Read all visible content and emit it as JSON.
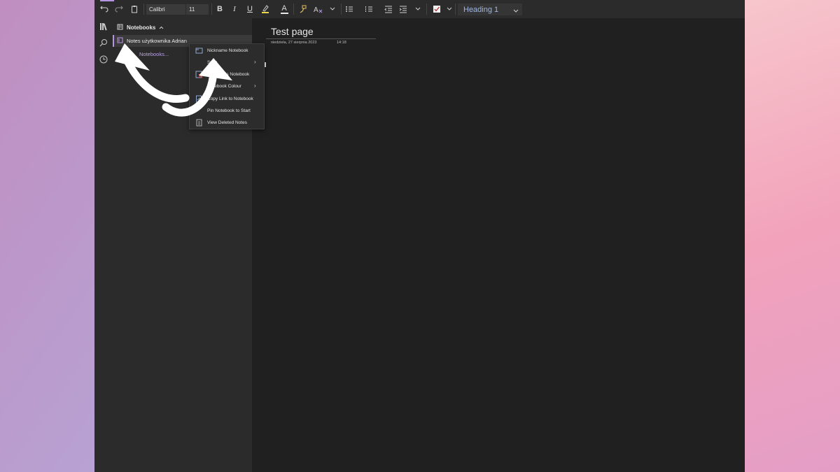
{
  "toolbar": {
    "font_name": "Calibri",
    "font_size": "11",
    "style": "Heading 1",
    "icons": [
      "undo-icon",
      "redo-icon",
      "clipboard-icon",
      "bold-icon",
      "italic-icon",
      "underline-icon",
      "highlight-icon",
      "font-color-icon",
      "format-painter-icon",
      "clear-format-icon",
      "bullets-icon",
      "numbering-icon",
      "outdent-icon",
      "indent-icon",
      "todo-checkbox-icon"
    ],
    "bold_glyph": "B",
    "italic_glyph": "I",
    "underline_glyph": "U",
    "font_color_glyph": "A"
  },
  "nav_rail": {
    "icons": [
      "notebooks-icon",
      "search-icon",
      "recent-icon"
    ]
  },
  "notebooks_pane": {
    "header": "Notebooks",
    "notebook_name": "Notes użytkownika Adrian",
    "more_link": "Notebooks..."
  },
  "page": {
    "title": "Test page",
    "date": "niedziela, 27 sierpnia 2023",
    "time": "14:18"
  },
  "context_menu": {
    "items": [
      {
        "label": "Nickname Notebook",
        "icon": "rename-icon",
        "submenu": false
      },
      {
        "label": "Sync",
        "icon": "sync-icon",
        "submenu": true
      },
      {
        "label": "Close This Notebook",
        "icon": "close-notebook-icon",
        "submenu": false
      },
      {
        "label": "Notebook Colour",
        "icon": "colour-icon",
        "submenu": true
      },
      {
        "label": "Copy Link to Notebook",
        "icon": "link-icon",
        "submenu": false
      },
      {
        "label": "Pin Notebook to Start",
        "icon": "pin-icon",
        "submenu": false
      },
      {
        "label": "View Deleted Notes",
        "icon": "deleted-notes-icon",
        "submenu": false
      }
    ],
    "submenu_arrow": "›"
  },
  "colors": {
    "accent": "#b695e0",
    "app_bg": "#202020",
    "pane_bg": "#2b2b2b",
    "close_icon_red": "#e0463c"
  }
}
